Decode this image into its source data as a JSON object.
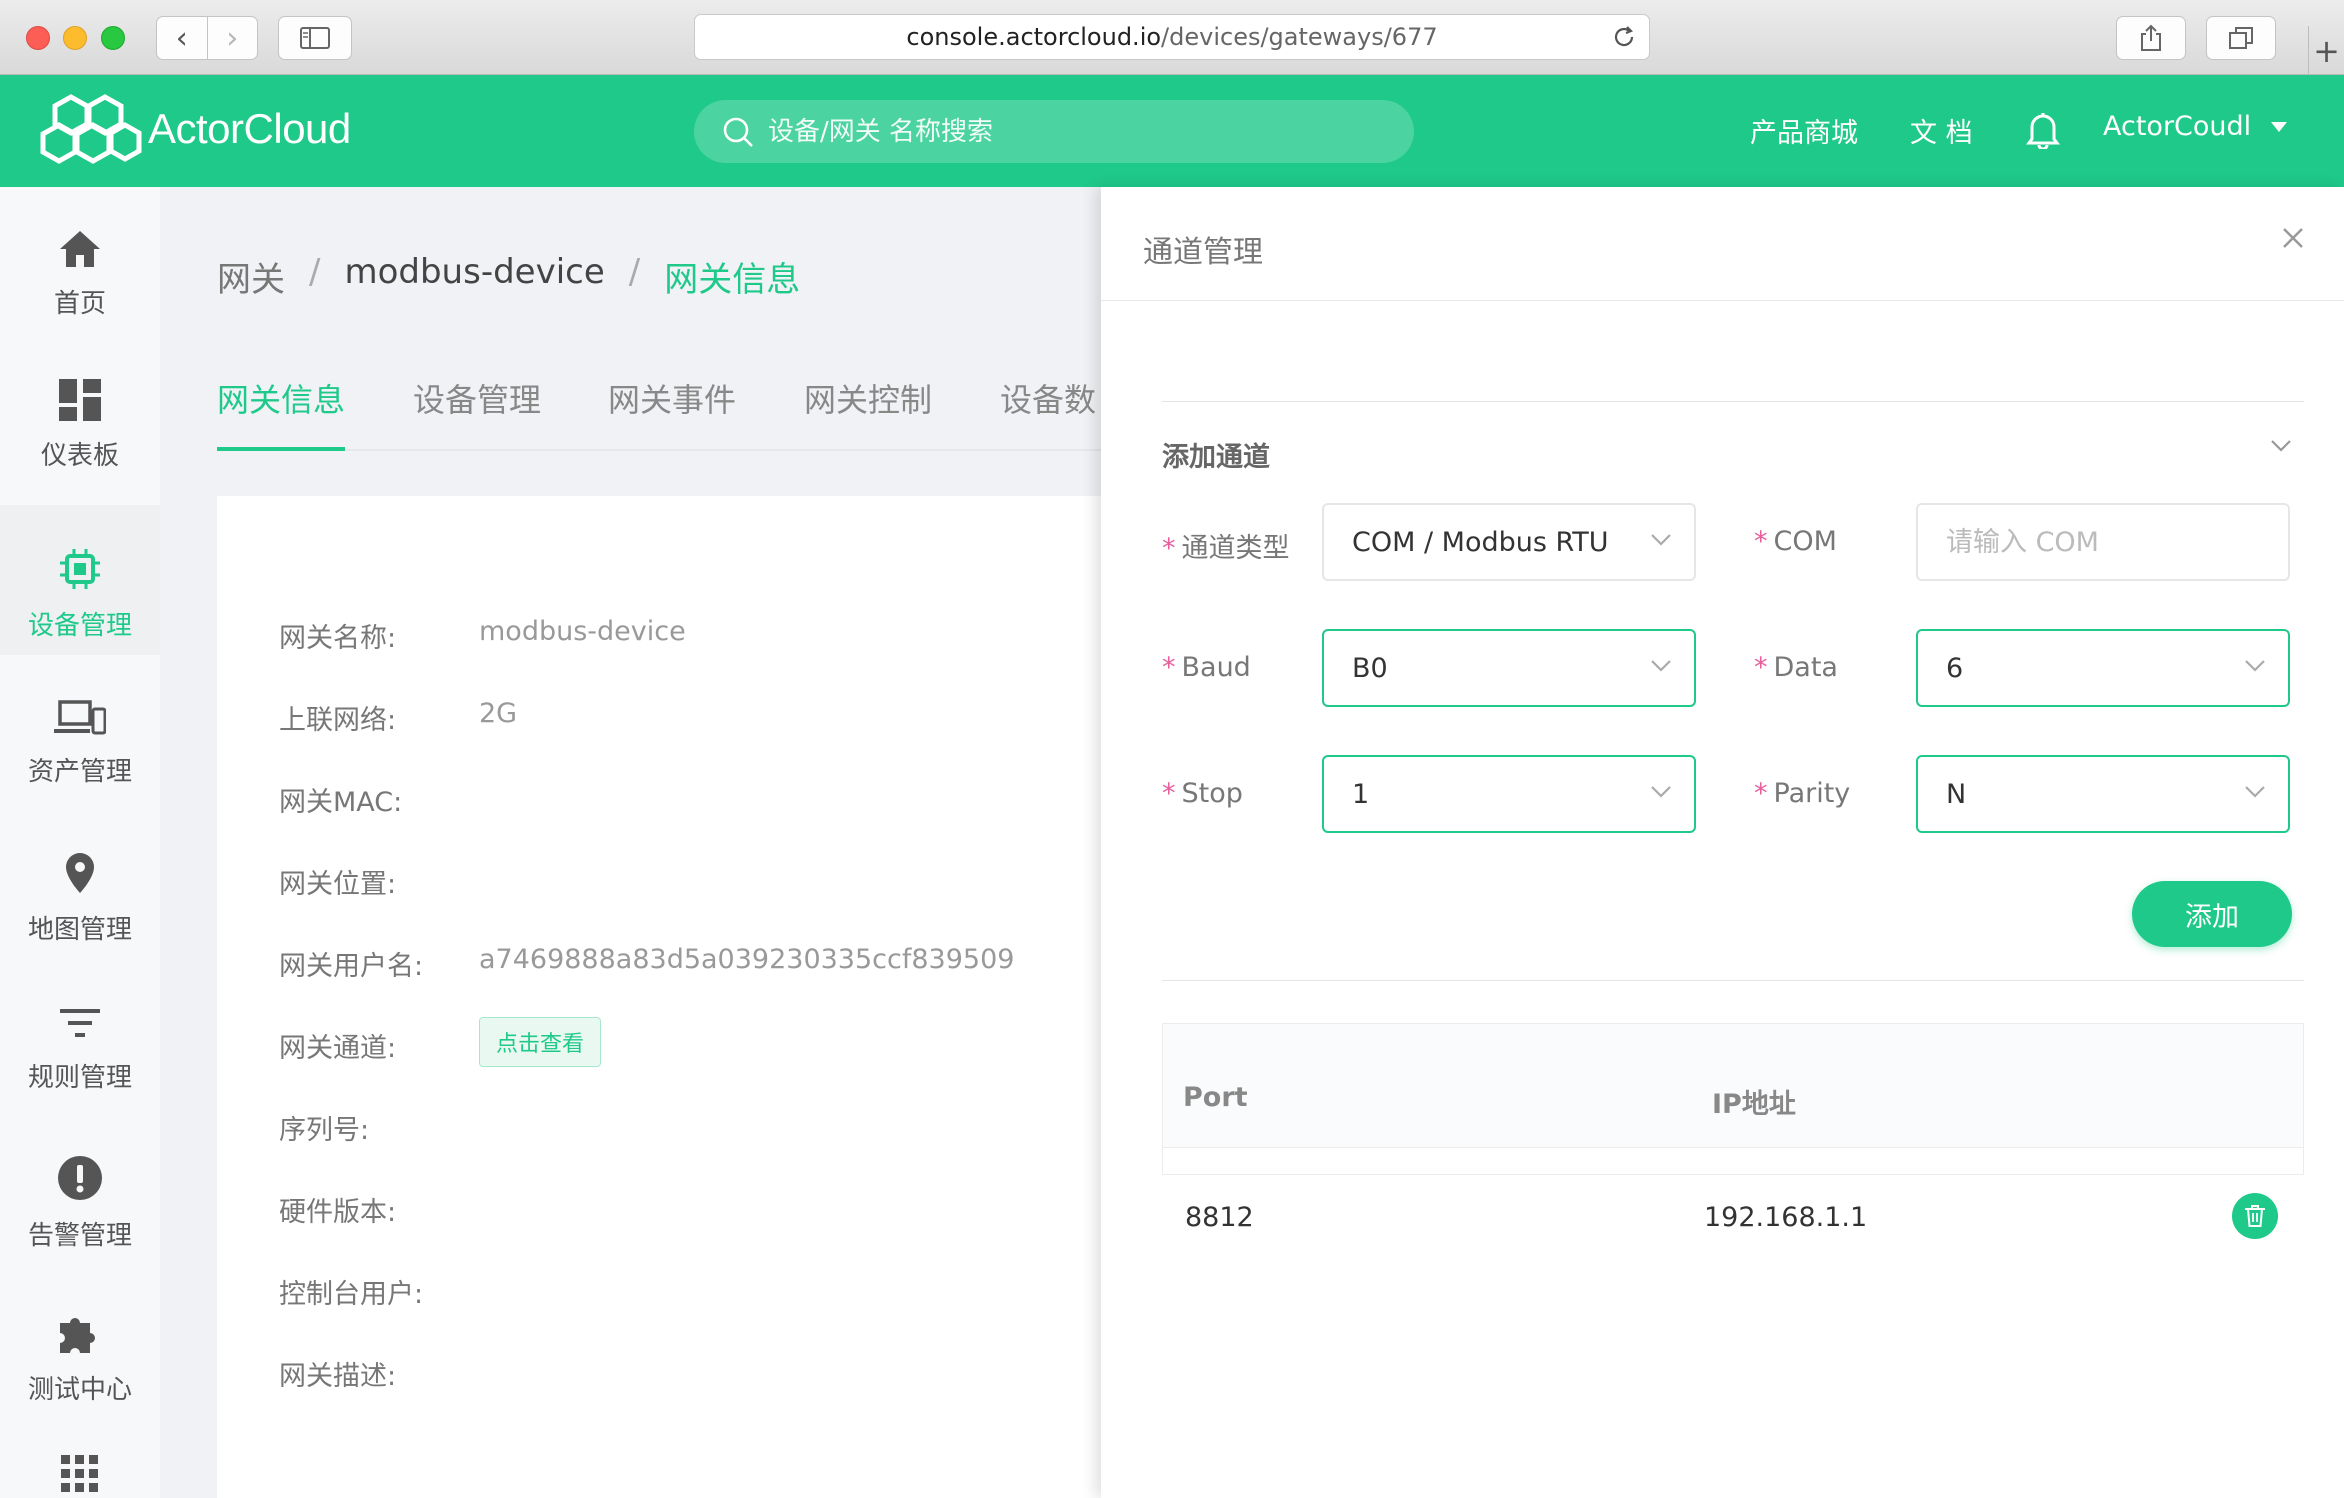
{
  "browser": {
    "url_host": "console.actorcloud.io",
    "url_path": "/devices/gateways/677"
  },
  "header": {
    "logo_text": "ActorCloud",
    "search_placeholder": "设备/网关 名称搜索",
    "links": [
      "产品商城",
      "文 档"
    ],
    "user": "ActorCoudl",
    "accent": "#1fc98a"
  },
  "sidebar": {
    "items": [
      {
        "label": "首页",
        "icon": "home-icon"
      },
      {
        "label": "仪表板",
        "icon": "dashboard-icon"
      },
      {
        "label": "设备管理",
        "icon": "chip-icon",
        "active": true
      },
      {
        "label": "资产管理",
        "icon": "devices-icon"
      },
      {
        "label": "地图管理",
        "icon": "map-pin-icon"
      },
      {
        "label": "规则管理",
        "icon": "filter-icon"
      },
      {
        "label": "告警管理",
        "icon": "alert-icon"
      },
      {
        "label": "测试中心",
        "icon": "puzzle-icon"
      }
    ]
  },
  "breadcrumb": [
    "网关",
    "modbus-device",
    "网关信息"
  ],
  "tabs": [
    "网关信息",
    "设备管理",
    "网关事件",
    "网关控制",
    "设备数"
  ],
  "info": {
    "rows": [
      {
        "label": "网关名称:",
        "value": "modbus-device"
      },
      {
        "label": "上联网络:",
        "value": "2G"
      },
      {
        "label": "网关MAC:",
        "value": ""
      },
      {
        "label": "网关位置:",
        "value": ""
      },
      {
        "label": "网关用户名:",
        "value": "a7469888a83d5a039230335ccf839509"
      },
      {
        "label": "网关通道:",
        "value": ""
      },
      {
        "label": "序列号:",
        "value": ""
      },
      {
        "label": "硬件版本:",
        "value": ""
      },
      {
        "label": "控制台用户:",
        "value": ""
      },
      {
        "label": "网关描述:",
        "value": ""
      }
    ],
    "view_button": "点击查看"
  },
  "drawer": {
    "title": "通道管理",
    "section_title": "添加通道",
    "fields": {
      "channel_type": {
        "label": "通道类型",
        "value": "COM / Modbus RTU"
      },
      "com": {
        "label": "COM",
        "placeholder": "请输入 COM"
      },
      "baud": {
        "label": "Baud",
        "value": "B0"
      },
      "data": {
        "label": "Data",
        "value": "6"
      },
      "stop": {
        "label": "Stop",
        "value": "1"
      },
      "parity": {
        "label": "Parity",
        "value": "N"
      }
    },
    "add_button": "添加",
    "table": {
      "headers": [
        "Port",
        "IP地址"
      ],
      "rows": [
        {
          "port": "8812",
          "ip": "192.168.1.1"
        }
      ]
    }
  }
}
